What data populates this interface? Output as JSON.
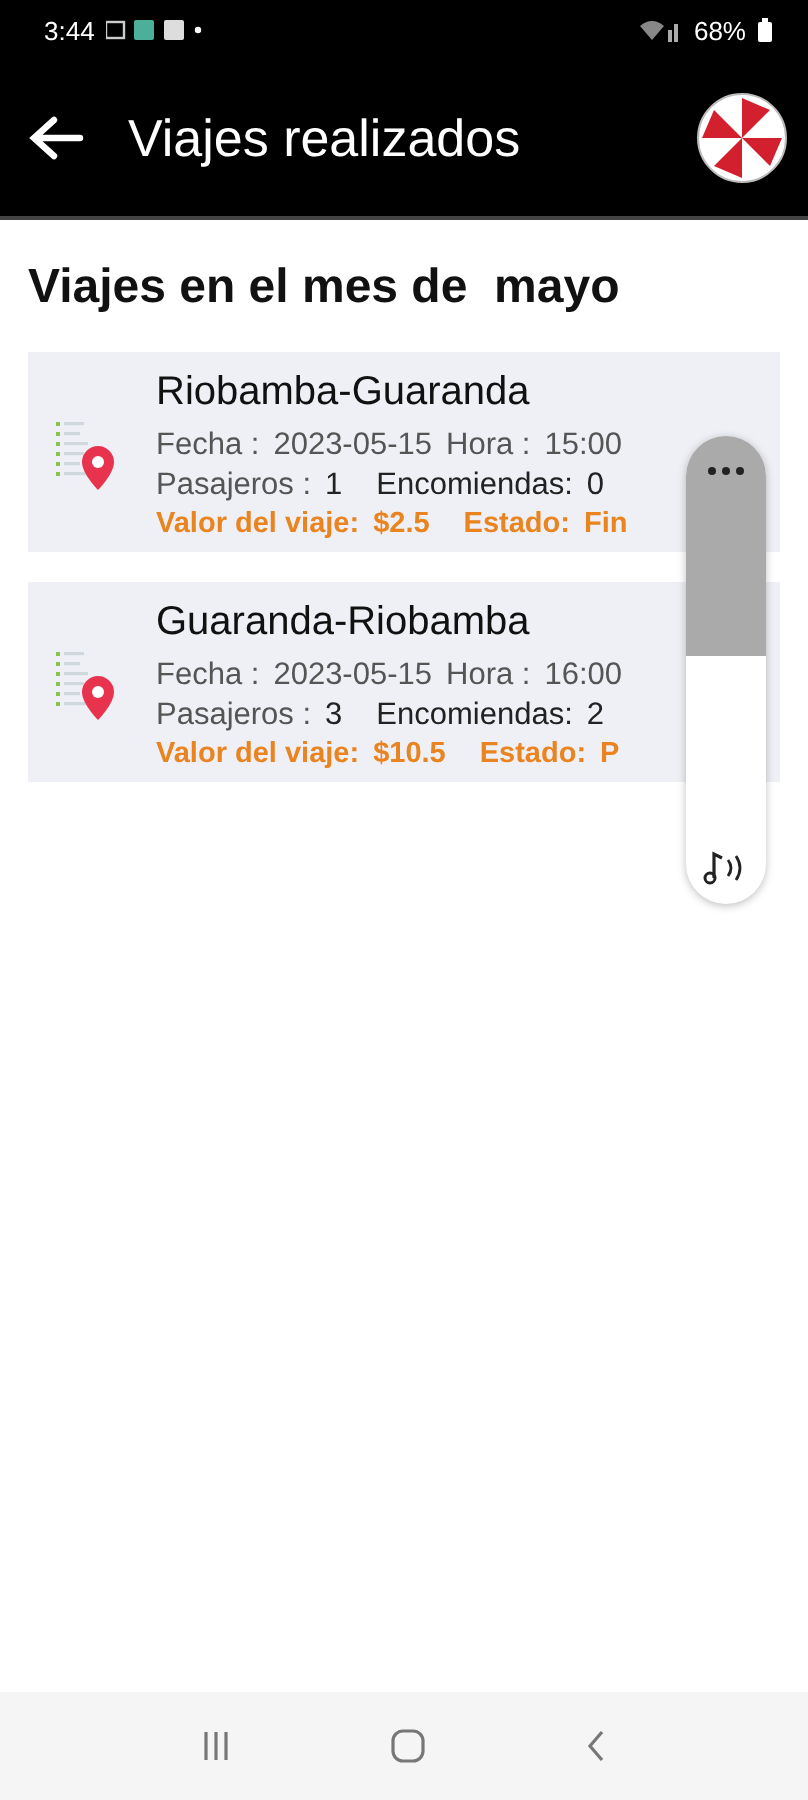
{
  "status_bar": {
    "time": "3:44",
    "battery": "68%"
  },
  "app_bar": {
    "title": "Viajes realizados"
  },
  "heading": "Viajes en el mes de  mayo",
  "trips": [
    {
      "route": "Riobamba-Guaranda",
      "date_label": "Fecha :",
      "date": "2023-05-15",
      "time_label": "Hora :",
      "time": "15:00",
      "passengers_label": "Pasajeros :",
      "passengers": "1",
      "parcels_label": "Encomiendas:",
      "parcels": "0",
      "value_label": "Valor del viaje:",
      "value": "$2.5",
      "status_label": "Estado:",
      "status": "Fin"
    },
    {
      "route": "Guaranda-Riobamba",
      "date_label": "Fecha :",
      "date": "2023-05-15",
      "time_label": "Hora :",
      "time": "16:00",
      "passengers_label": "Pasajeros :",
      "passengers": "3",
      "parcels_label": "Encomiendas:",
      "parcels": "2",
      "value_label": "Valor del viaje:",
      "value": "$10.5",
      "status_label": "Estado:",
      "status": "P"
    }
  ]
}
